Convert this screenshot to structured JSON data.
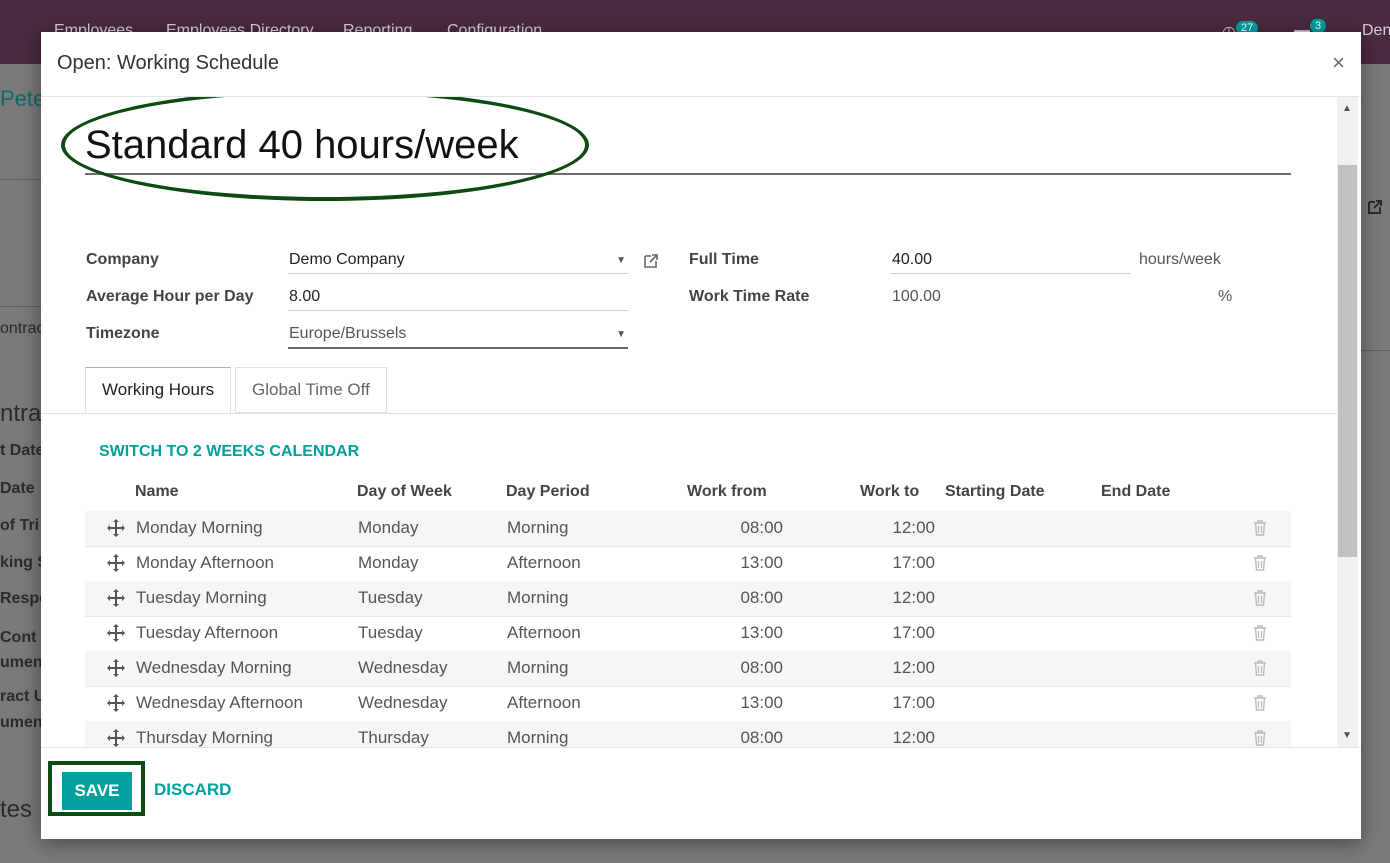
{
  "background": {
    "nav": [
      "Employees",
      "Employees Directory",
      "Reporting",
      "Configuration"
    ],
    "activity_count": "27",
    "message_count": "3",
    "user_fragment": "Den",
    "page_fragments": [
      "Peter",
      "ontrac",
      "ntra",
      "t Date",
      "Date",
      "of Tri",
      "king S",
      "Respo",
      "Cont",
      "umen",
      "ract U",
      "umen",
      "tes"
    ]
  },
  "modal": {
    "title": "Open: Working Schedule",
    "close_symbol": "×",
    "record_name": "Standard 40 hours/week",
    "fields": {
      "company_label": "Company",
      "company_value": "Demo Company",
      "avg_hour_label": "Average Hour per Day",
      "avg_hour_value": "8.00",
      "timezone_label": "Timezone",
      "timezone_value": "Europe/Brussels",
      "full_time_label": "Full Time",
      "full_time_value": "40.00",
      "full_time_unit": "hours/week",
      "work_rate_label": "Work Time Rate",
      "work_rate_value": "100.00",
      "work_rate_unit": "%"
    },
    "tabs": [
      {
        "label": "Working Hours",
        "active": true
      },
      {
        "label": "Global Time Off",
        "active": false
      }
    ],
    "switch_link": "SWITCH TO 2 WEEKS CALENDAR",
    "columns": [
      "Name",
      "Day of Week",
      "Day Period",
      "Work from",
      "Work to",
      "Starting Date",
      "End Date"
    ],
    "rows": [
      {
        "name": "Monday Morning",
        "day": "Monday",
        "period": "Morning",
        "from": "08:00",
        "to": "12:00",
        "start": "",
        "end": ""
      },
      {
        "name": "Monday Afternoon",
        "day": "Monday",
        "period": "Afternoon",
        "from": "13:00",
        "to": "17:00",
        "start": "",
        "end": ""
      },
      {
        "name": "Tuesday Morning",
        "day": "Tuesday",
        "period": "Morning",
        "from": "08:00",
        "to": "12:00",
        "start": "",
        "end": ""
      },
      {
        "name": "Tuesday Afternoon",
        "day": "Tuesday",
        "period": "Afternoon",
        "from": "13:00",
        "to": "17:00",
        "start": "",
        "end": ""
      },
      {
        "name": "Wednesday Morning",
        "day": "Wednesday",
        "period": "Morning",
        "from": "08:00",
        "to": "12:00",
        "start": "",
        "end": ""
      },
      {
        "name": "Wednesday Afternoon",
        "day": "Wednesday",
        "period": "Afternoon",
        "from": "13:00",
        "to": "17:00",
        "start": "",
        "end": ""
      },
      {
        "name": "Thursday Morning",
        "day": "Thursday",
        "period": "Morning",
        "from": "08:00",
        "to": "12:00",
        "start": "",
        "end": ""
      }
    ],
    "save_label": "SAVE",
    "discard_label": "DISCARD"
  },
  "colors": {
    "accent": "#00a09d",
    "topbar": "#4a2a40",
    "annotation": "#0d4a14"
  }
}
